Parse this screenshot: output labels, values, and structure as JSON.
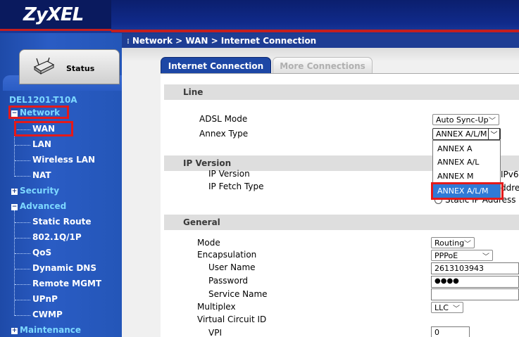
{
  "header": {
    "logo_text": "ZyXEL"
  },
  "sidebar": {
    "status_label": "Status",
    "device_name": "DEL1201-T10A",
    "network": "Network",
    "network_items": [
      "WAN",
      "LAN",
      "Wireless LAN",
      "NAT"
    ],
    "security": "Security",
    "advanced": "Advanced",
    "advanced_items": [
      "Static Route",
      "802.1Q/1P",
      "QoS",
      "Dynamic DNS",
      "Remote MGMT",
      "UPnP",
      "CWMP"
    ],
    "maintenance": "Maintenance",
    "expand_symbol": "+",
    "collapse_symbol": "−"
  },
  "breadcrumb": "Network > WAN > Internet Connection",
  "tabs": {
    "internet": "Internet Connection",
    "more": "More Connections"
  },
  "line": {
    "title": "Line",
    "adsl_mode_label": "ADSL Mode",
    "adsl_mode_value": "Auto Sync-Up",
    "annex_label": "Annex Type",
    "annex_value": "ANNEX A/L/M",
    "annex_options": [
      "ANNEX A",
      "ANNEX A/L",
      "ANNEX M",
      "ANNEX A/L/M"
    ]
  },
  "ip_version": {
    "title": "IP Version",
    "ip_version_label": "IP Version",
    "ip_version_value_partial": "IPv6",
    "ip_fetch_label": "IP Fetch Type",
    "ip_fetch_partial": "ddre",
    "static_ip_partial": "Static IP Address"
  },
  "general": {
    "title": "General",
    "mode_label": "Mode",
    "mode_value": "Routing",
    "encapsulation_label": "Encapsulation",
    "encapsulation_value": "PPPoE",
    "username_label": "User Name",
    "username_value": "2613103943",
    "password_label": "Password",
    "password_value": "●●●●",
    "service_label": "Service Name",
    "service_value": "",
    "multiplex_label": "Multiplex",
    "multiplex_value": "LLC",
    "vci_label": "Virtual Circuit ID",
    "vpi_label": "VPI",
    "vpi_value": "0"
  },
  "icons": {
    "router": "router-icon",
    "chevron": "chevron-down-icon"
  },
  "colors": {
    "accent": "#1d47a5",
    "highlight": "#e41a1a",
    "selected_option": "#2f7ad6"
  }
}
